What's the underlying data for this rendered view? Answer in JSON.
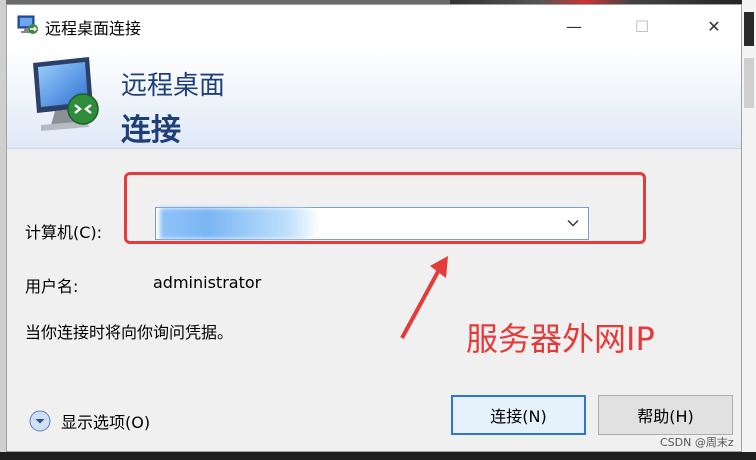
{
  "window": {
    "title": "远程桌面连接",
    "controls": {
      "minimize": "—",
      "maximize": "☐",
      "close": "✕"
    }
  },
  "banner": {
    "line1": "远程桌面",
    "line2": "连接"
  },
  "form": {
    "computer_label": "计算机(C):",
    "computer_value": "",
    "username_label": "用户名:",
    "username_value": "administrator",
    "hint": "当你连接时将向你询问凭据。"
  },
  "annotation": {
    "text": "服务器外网IP",
    "color": "#e63a3a"
  },
  "footer": {
    "show_options": "显示选项(O)",
    "connect_button": "连接(N)",
    "help_button": "帮助(H)"
  },
  "watermark": "CSDN @周末z",
  "icons": {
    "title": "remote-desktop-icon",
    "banner": "monitor-connection-icon",
    "dropdown": "chevron-down-icon",
    "options": "chevron-circle-down-icon"
  }
}
